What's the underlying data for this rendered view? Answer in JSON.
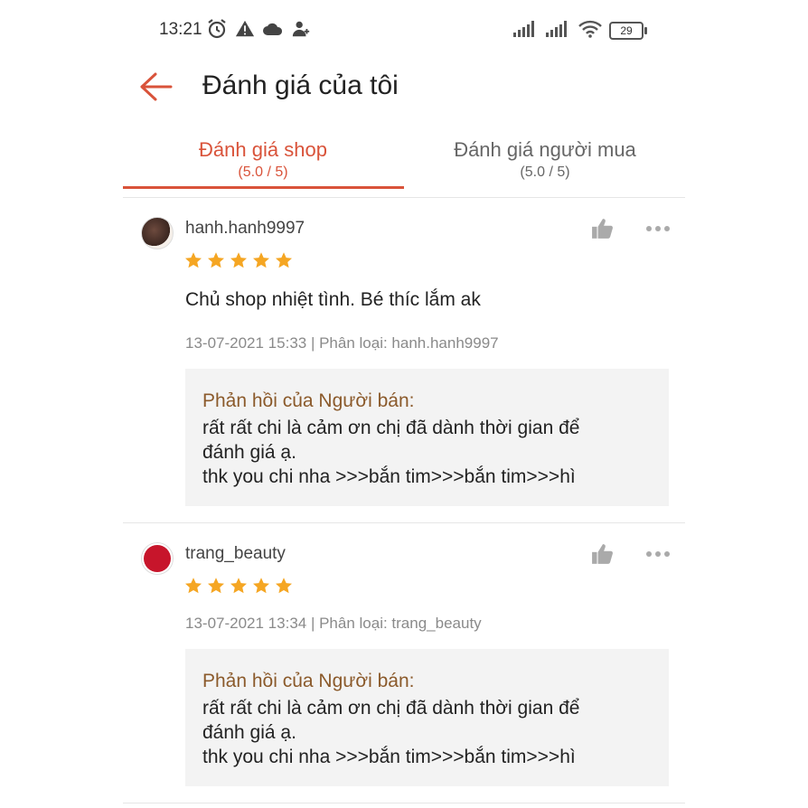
{
  "status_bar": {
    "time": "13:21",
    "battery": "29",
    "icons": [
      "alarm-icon",
      "warning-icon",
      "cloud-icon",
      "add-person-icon",
      "signal-icon",
      "signal-icon",
      "wifi-icon",
      "battery-icon"
    ]
  },
  "header": {
    "back_icon": "arrow-left-icon",
    "title": "Đánh giá của tôi"
  },
  "tabs": [
    {
      "label": "Đánh giá shop",
      "sub": "(5.0 / 5)",
      "active": true
    },
    {
      "label": "Đánh giá người mua",
      "sub": "(5.0 / 5)",
      "active": false
    }
  ],
  "colors": {
    "accent": "#d9533a",
    "star": "#f5a623",
    "reply_title": "#8b5a2b",
    "reply_bg": "#f3f3f3"
  },
  "reviews": [
    {
      "username": "hanh.hanh9997",
      "rating": 5,
      "comment": "Chủ shop nhiệt tình. Bé thíc lắm ak",
      "meta": "13-07-2021 15:33 | Phân loại: hanh.hanh9997",
      "reply_title": "Phản hồi của Người bán:",
      "reply_text": "rất rất chi là cảm ơn chị đã dành thời gian để\nđánh giá ạ.\nthk you chi nha >>>bắn tim>>>bắn tim>>>hì"
    },
    {
      "username": "trang_beauty",
      "rating": 5,
      "comment": "",
      "meta": "13-07-2021 13:34 | Phân loại: trang_beauty",
      "reply_title": "Phản hồi của Người bán:",
      "reply_text": "rất rất chi là cảm ơn chị đã dành thời gian để\nđánh giá ạ.\nthk you chi nha >>>bắn tim>>>bắn tim>>>hì"
    }
  ]
}
